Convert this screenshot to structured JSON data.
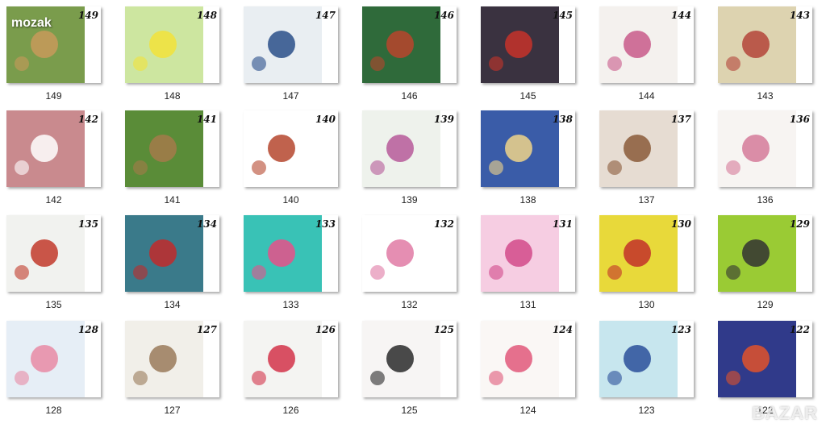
{
  "watermark_left": "mozak",
  "watermark_right": "BAZAR",
  "items": [
    {
      "caption": "149",
      "tag": "149",
      "bg": "#7a9c4c",
      "accent": "#c89a5a"
    },
    {
      "caption": "148",
      "tag": "148",
      "bg": "#cde6a0",
      "accent": "#f2e23a"
    },
    {
      "caption": "147",
      "tag": "147",
      "bg": "#e9eef2",
      "accent": "#2a4f8a"
    },
    {
      "caption": "146",
      "tag": "146",
      "bg": "#2f6a3a",
      "accent": "#b8442d"
    },
    {
      "caption": "145",
      "tag": "145",
      "bg": "#3a3240",
      "accent": "#c7332a"
    },
    {
      "caption": "144",
      "tag": "144",
      "bg": "#f4f1ee",
      "accent": "#c85a8a"
    },
    {
      "caption": "143",
      "tag": "143",
      "bg": "#ddd3b0",
      "accent": "#b4443a"
    },
    {
      "caption": "142",
      "tag": "142",
      "bg": "#c98a8e",
      "accent": "#ffffff"
    },
    {
      "caption": "141",
      "tag": "141",
      "bg": "#5a8c38",
      "accent": "#a57a4a"
    },
    {
      "caption": "140",
      "tag": "140",
      "bg": "#ffffff",
      "accent": "#b5472e"
    },
    {
      "caption": "139",
      "tag": "139",
      "bg": "#eef2ec",
      "accent": "#b65a9a"
    },
    {
      "caption": "138",
      "tag": "138",
      "bg": "#3a5ca8",
      "accent": "#f0d38a"
    },
    {
      "caption": "137",
      "tag": "137",
      "bg": "#e6dcd2",
      "accent": "#8a5a3a"
    },
    {
      "caption": "136",
      "tag": "136",
      "bg": "#f7f4f2",
      "accent": "#d57a9a"
    },
    {
      "caption": "135",
      "tag": "135",
      "bg": "#f1f2ef",
      "accent": "#c23a2a"
    },
    {
      "caption": "134",
      "tag": "134",
      "bg": "#3a7a8a",
      "accent": "#c22a2a"
    },
    {
      "caption": "133",
      "tag": "133",
      "bg": "#39c2b6",
      "accent": "#e8508a"
    },
    {
      "caption": "132",
      "tag": "132",
      "bg": "#ffffff",
      "accent": "#e07aa5"
    },
    {
      "caption": "131",
      "tag": "131",
      "bg": "#f6cde2",
      "accent": "#d24a8a"
    },
    {
      "caption": "130",
      "tag": "130",
      "bg": "#e8d93a",
      "accent": "#c2302a"
    },
    {
      "caption": "129",
      "tag": "129",
      "bg": "#9acb34",
      "accent": "#333333"
    },
    {
      "caption": "128",
      "tag": "128",
      "bg": "#e6eef6",
      "accent": "#e88aa5"
    },
    {
      "caption": "127",
      "tag": "127",
      "bg": "#f1efe9",
      "accent": "#9a7a5a"
    },
    {
      "caption": "126",
      "tag": "126",
      "bg": "#f4f4f2",
      "accent": "#d2324a"
    },
    {
      "caption": "125",
      "tag": "125",
      "bg": "#f7f5f4",
      "accent": "#2a2a2a"
    },
    {
      "caption": "124",
      "tag": "124",
      "bg": "#faf7f5",
      "accent": "#e0587a"
    },
    {
      "caption": "123",
      "tag": "123",
      "bg": "#c7e6ee",
      "accent": "#2a4f9a"
    },
    {
      "caption": "122",
      "tag": "122",
      "bg": "#303a8a",
      "accent": "#e0522a"
    }
  ]
}
